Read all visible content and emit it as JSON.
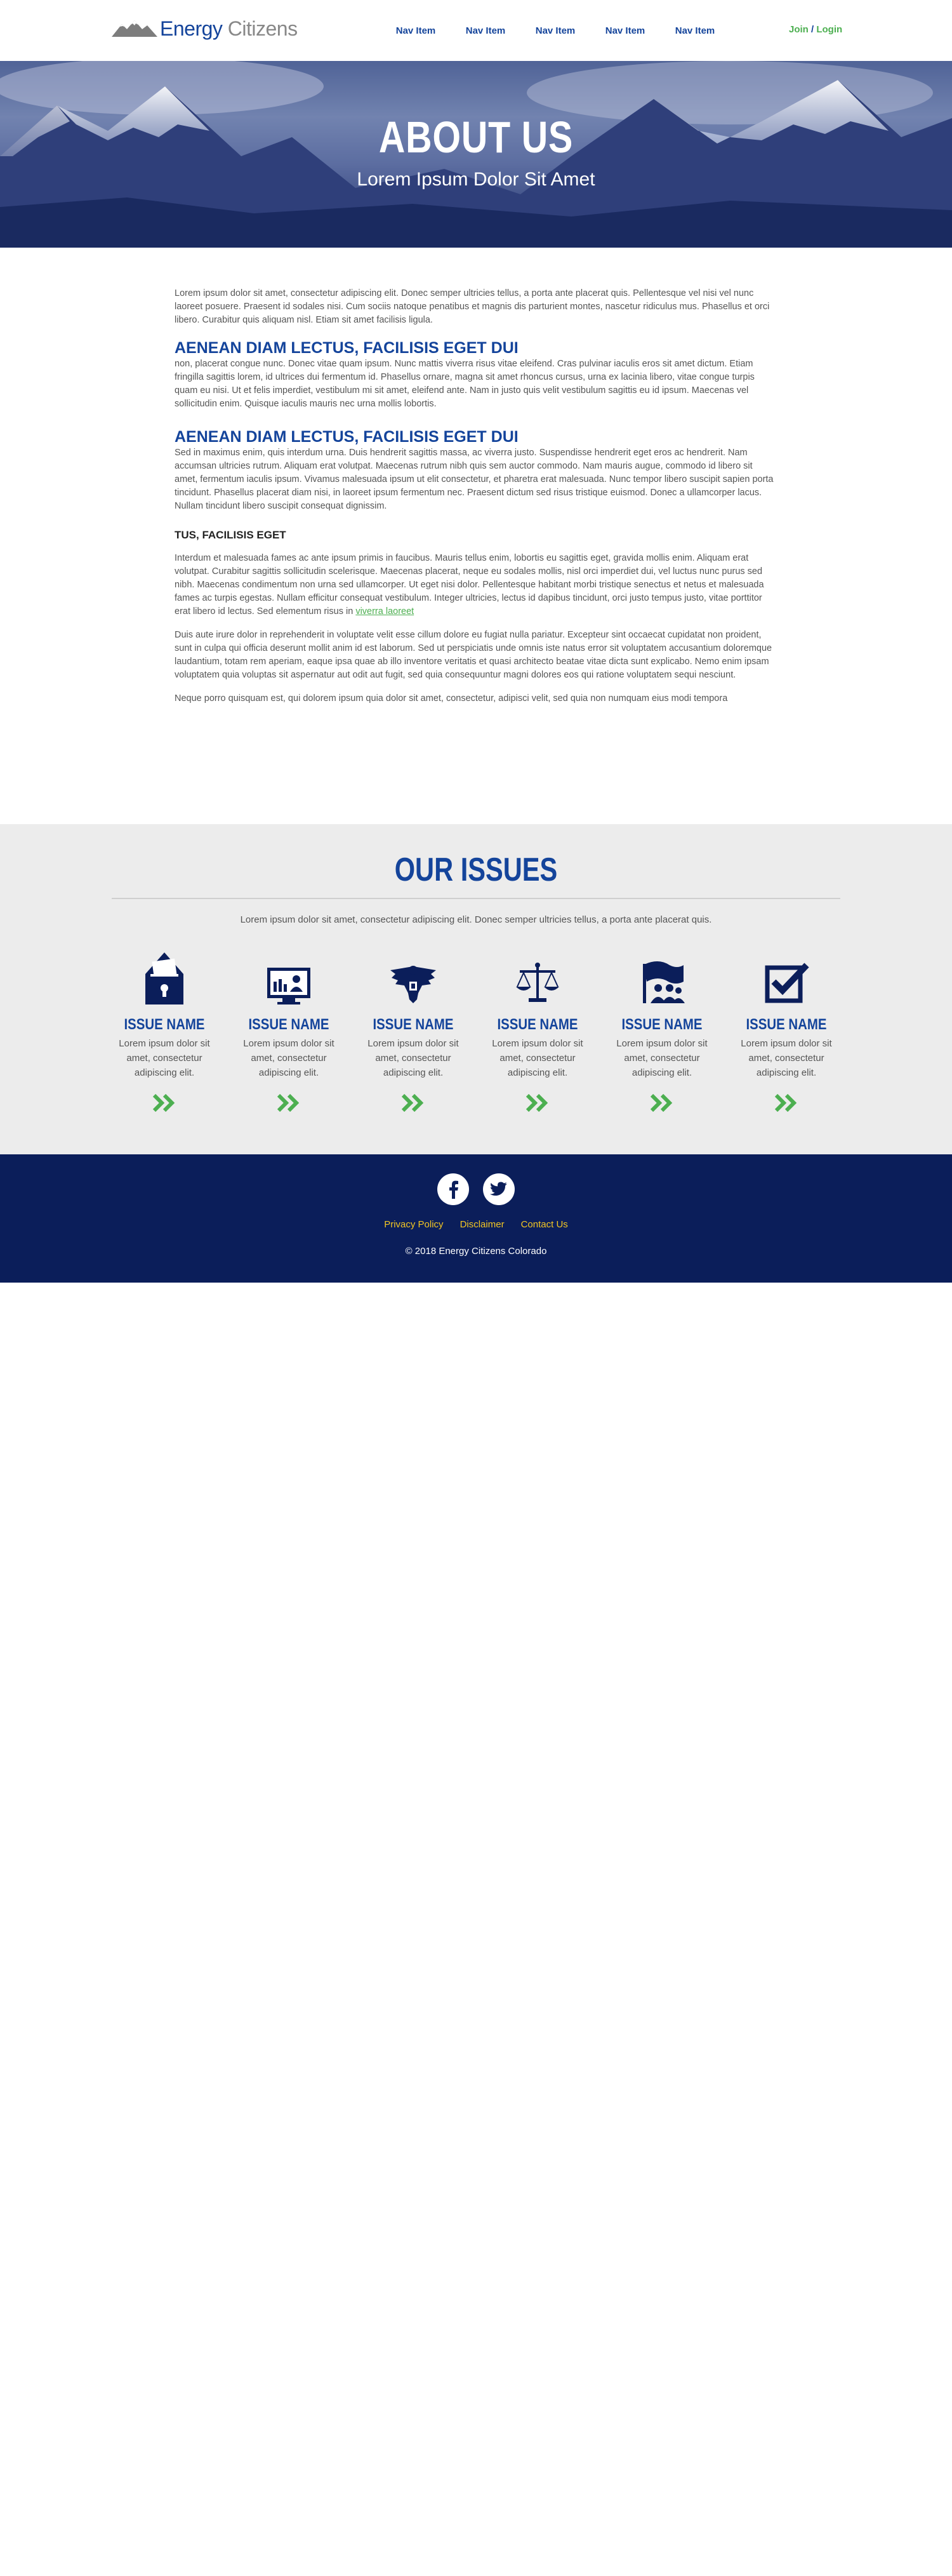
{
  "header": {
    "logo_word1": "Energy",
    "logo_word2": "Citizens",
    "nav": [
      "Nav Item",
      "Nav Item",
      "Nav Item",
      "Nav Item",
      "Nav Item"
    ],
    "join": "Join",
    "separator": "/",
    "login": "Login"
  },
  "hero": {
    "title": "ABOUT US",
    "subtitle": "Lorem Ipsum Dolor Sit Amet"
  },
  "content": {
    "p1": "Lorem ipsum dolor sit amet, consectetur adipiscing elit. Donec semper ultricies tellus, a porta ante placerat quis. Pellentesque vel nisi vel nunc laoreet posuere. Praesent id sodales nisi. Cum sociis natoque penatibus et magnis dis parturient montes, nascetur ridiculus mus. Phasellus et orci libero. Curabitur quis aliquam nisl. Etiam sit amet facilisis ligula.",
    "h2a": "AENEAN DIAM LECTUS, FACILISIS EGET DUI",
    "p2": "non, placerat congue nunc. Donec vitae quam ipsum. Nunc mattis viverra risus vitae eleifend. Cras pulvinar iaculis eros sit amet dictum. Etiam fringilla sagittis lorem, id ultrices dui fermentum id. Phasellus ornare, magna sit amet rhoncus cursus, urna ex lacinia libero, vitae congue turpis quam eu nisi. Ut et felis imperdiet, vestibulum mi sit amet, eleifend ante. Nam in justo quis velit vestibulum sagittis eu id ipsum. Maecenas vel sollicitudin enim. Quisque iaculis mauris nec urna mollis lobortis.",
    "h2b": "AENEAN DIAM LECTUS, FACILISIS EGET DUI",
    "p3": "Sed in maximus enim, quis interdum urna. Duis hendrerit sagittis massa, ac viverra justo. Suspendisse hendrerit eget eros ac hendrerit. Nam accumsan ultricies rutrum. Aliquam erat volutpat. Maecenas rutrum nibh quis sem auctor commodo. Nam mauris augue, commodo id libero sit amet, fermentum iaculis ipsum. Vivamus malesuada ipsum ut elit consectetur, et pharetra erat malesuada. Nunc tempor libero suscipit sapien porta tincidunt. Phasellus placerat diam nisi, in laoreet ipsum fermentum nec. Praesent dictum sed risus tristique euismod. Donec a ullamcorper lacus. Nullam tincidunt libero suscipit consequat dignissim.",
    "h3": "TUS, FACILISIS EGET",
    "p4": "Interdum et malesuada fames ac ante ipsum primis in faucibus. Mauris tellus enim, lobortis eu sagittis eget, gravida mollis enim. Aliquam erat volutpat. Curabitur sagittis sollicitudin scelerisque. Maecenas placerat, neque eu sodales mollis, nisl orci imperdiet dui, vel luctus nunc purus sed nibh. Maecenas condimentum non urna sed ullamcorper. Ut eget nisi dolor. Pellentesque habitant morbi tristique senectus et netus et malesuada fames ac turpis egestas. Nullam efficitur consequat vestibulum. Integer ultricies, lectus id dapibus tincidunt, orci justo tempus justo, vitae porttitor erat libero id lectus. Sed elementum risus in",
    "p4_link": "viverra laoreet",
    "p5": "Duis aute irure dolor in reprehenderit in voluptate velit esse cillum dolore eu fugiat nulla pariatur. Excepteur sint occaecat cupidatat non proident, sunt in culpa qui officia deserunt mollit anim id est laborum. Sed ut perspiciatis unde omnis iste natus error sit voluptatem accusantium doloremque laudantium, totam rem aperiam, eaque ipsa quae ab illo inventore veritatis et quasi architecto beatae vitae dicta sunt explicabo. Nemo enim ipsam voluptatem quia voluptas sit aspernatur aut odit aut fugit, sed quia consequuntur magni dolores eos qui ratione voluptatem sequi nesciunt.",
    "p6": "Neque porro quisquam est, qui dolorem ipsum quia dolor sit amet, consectetur, adipisci velit, sed quia non numquam eius modi tempora"
  },
  "issues": {
    "title": "OUR ISSUES",
    "intro": "Lorem ipsum dolor sit amet, consectetur adipiscing elit. Donec semper ultricies tellus, a porta ante placerat quis.",
    "items": [
      {
        "icon": "ballot-box-icon",
        "name": "ISSUE NAME",
        "desc": "Lorem ipsum dolor sit amet, consectetur adipiscing elit."
      },
      {
        "icon": "monitor-icon",
        "name": "ISSUE NAME",
        "desc": "Lorem ipsum dolor sit amet, consectetur adipiscing elit."
      },
      {
        "icon": "eagle-icon",
        "name": "ISSUE NAME",
        "desc": "Lorem ipsum dolor sit amet, consectetur adipiscing elit."
      },
      {
        "icon": "scales-icon",
        "name": "ISSUE NAME",
        "desc": "Lorem ipsum dolor sit amet, consectetur adipiscing elit."
      },
      {
        "icon": "flag-people-icon",
        "name": "ISSUE NAME",
        "desc": "Lorem ipsum dolor sit amet, consectetur adipiscing elit."
      },
      {
        "icon": "checkbox-icon",
        "name": "ISSUE NAME",
        "desc": "Lorem ipsum dolor sit amet, consectetur adipiscing elit."
      }
    ]
  },
  "footer": {
    "social": [
      "facebook-icon",
      "twitter-icon"
    ],
    "links": [
      "Privacy Policy",
      "Disclaimer",
      "Contact Us"
    ],
    "copyright": "© 2018 Energy Citizens Colorado"
  },
  "colors": {
    "brand_blue": "#14449b",
    "navy": "#0b1e5a",
    "green": "#4caf50",
    "gold": "#f3c623",
    "gray_band": "#ececec"
  }
}
